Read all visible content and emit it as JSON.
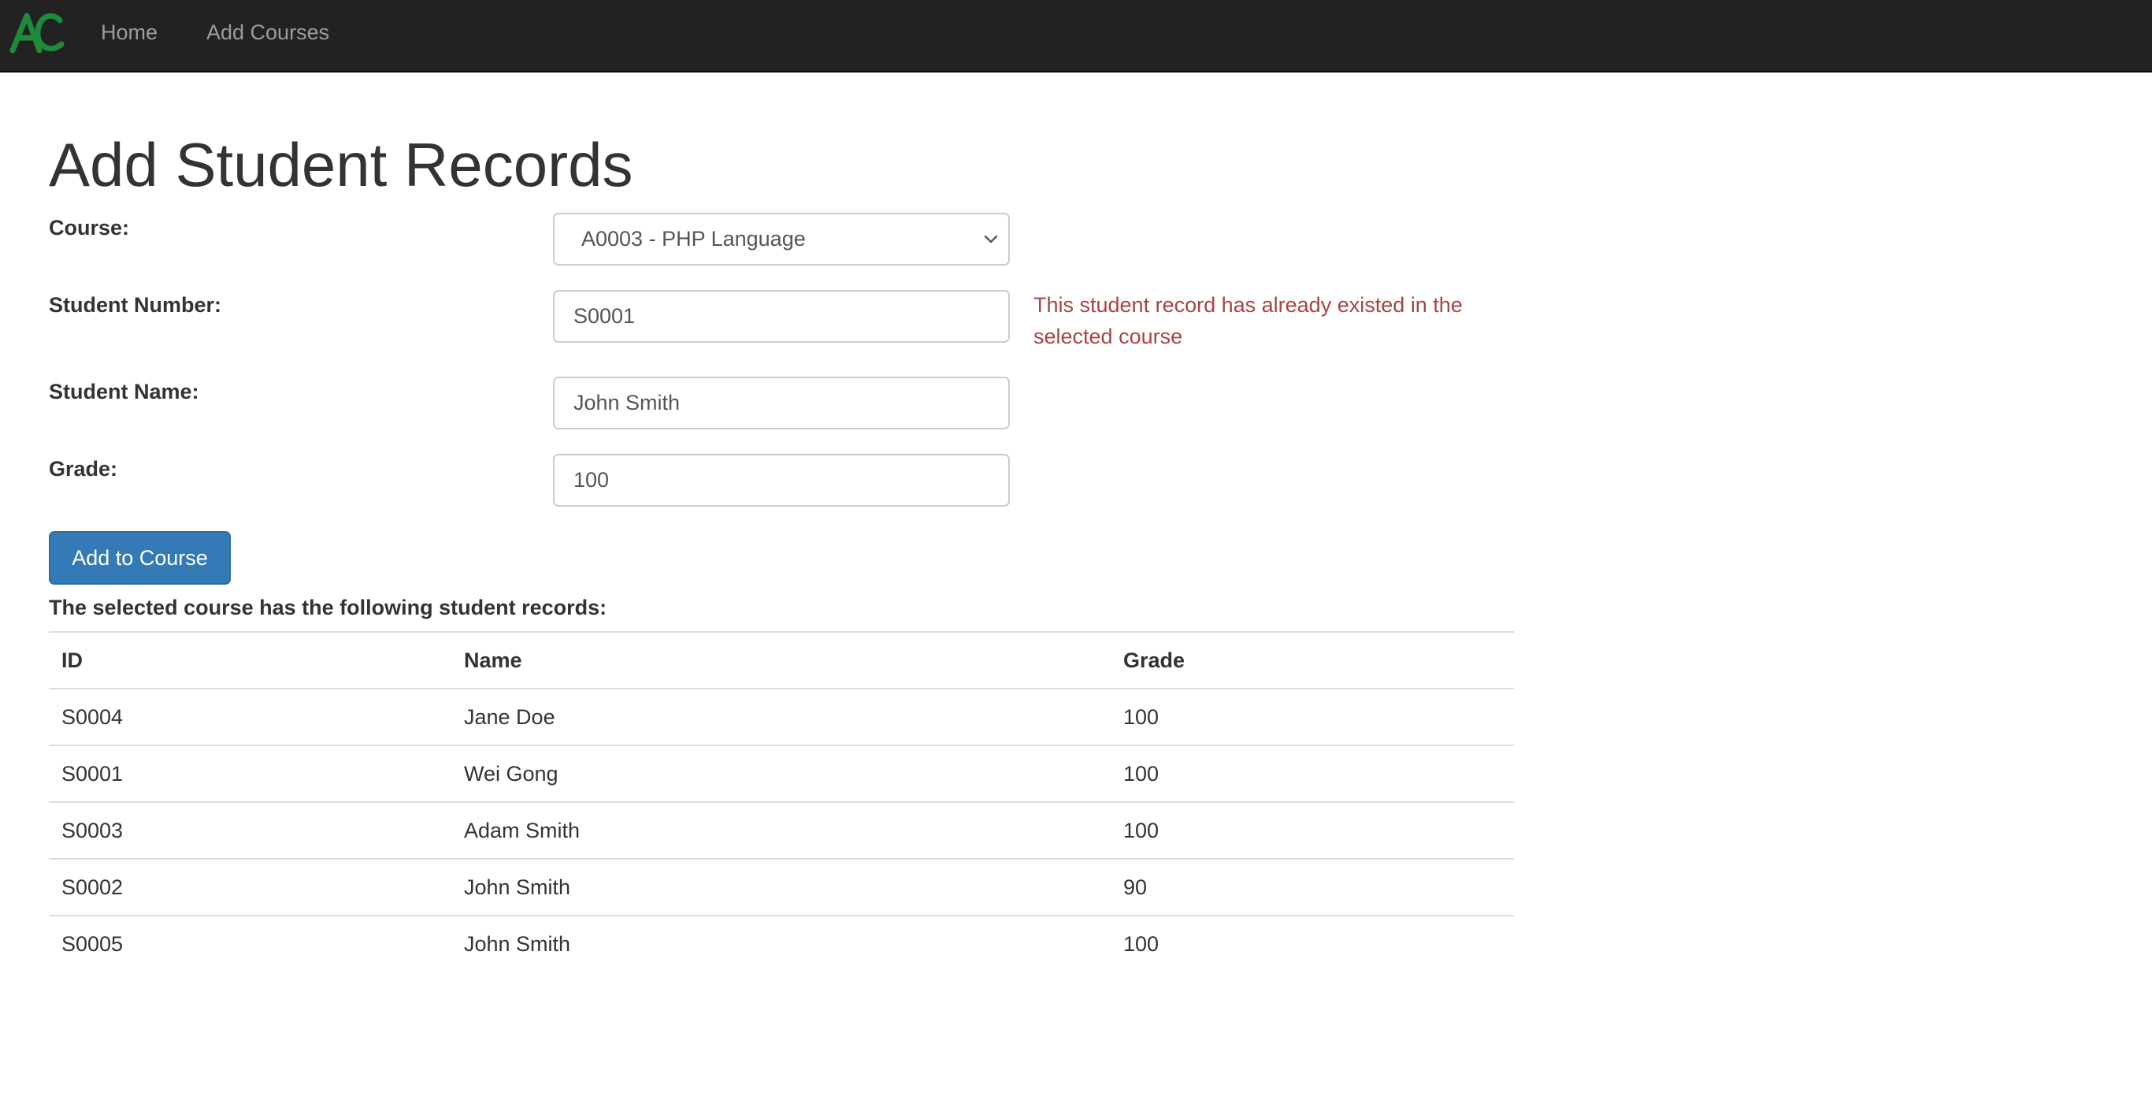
{
  "navbar": {
    "logo_text": "AC",
    "links": [
      "Home",
      "Add Courses"
    ]
  },
  "page": {
    "title": "Add Student Records"
  },
  "form": {
    "course": {
      "label": "Course:",
      "selected": "A0003 - PHP Language"
    },
    "student_number": {
      "label": "Student Number:",
      "value": "S0001",
      "error": "This student record has already existed in the selected course"
    },
    "student_name": {
      "label": "Student Name:",
      "value": "John Smith"
    },
    "grade": {
      "label": "Grade:",
      "value": "100"
    },
    "submit_label": "Add to Course"
  },
  "records": {
    "caption": "The selected course has the following student records:",
    "headers": [
      "ID",
      "Name",
      "Grade"
    ],
    "rows": [
      [
        "S0004",
        "Jane Doe",
        "100"
      ],
      [
        "S0001",
        "Wei Gong",
        "100"
      ],
      [
        "S0003",
        "Adam Smith",
        "100"
      ],
      [
        "S0002",
        "John Smith",
        "90"
      ],
      [
        "S0005",
        "John Smith",
        "100"
      ]
    ]
  },
  "colors": {
    "navbar_bg": "#222222",
    "nav_link": "#9d9d9d",
    "logo_green": "#1e8a3c",
    "primary_button": "#337ab7",
    "error_text": "#a94442"
  }
}
